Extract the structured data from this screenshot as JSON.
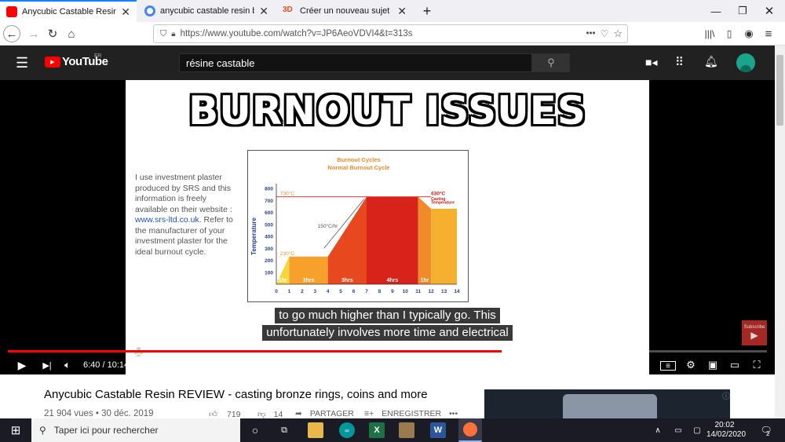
{
  "browser": {
    "tabs": [
      {
        "title": "Anycubic Castable Resin REVIEW",
        "favicon_color": "#ff0000",
        "active": true
      },
      {
        "title": "anycubic castable resin burnout",
        "favicon_color": "#4285f4",
        "active": false
      },
      {
        "title": "Créer un nouveau sujet - Forum",
        "favicon_color": "#e8491d",
        "active": false
      }
    ],
    "new_tab": "+",
    "url": "https://www.youtube.com/watch?v=JP6AeoVDVI4&t=313s",
    "url_more": "•••"
  },
  "youtube": {
    "logo": "YouTube",
    "region": "FR",
    "search_value": "résine castable"
  },
  "video": {
    "headline": "BURNOUT ISSUES",
    "side_text": "I use investment plaster produced by SRS and this information is freely available on their website : ",
    "side_link": "www.srs-ltd.co.uk",
    "side_text2": ". Refer to the manufacturer of your investment plaster for the ideal burnout cycle.",
    "captions": [
      "to go much higher than I typically go. This",
      "unfortunately involves more time and electrical"
    ],
    "time": "6:40 / 10:14",
    "progress": 0.65,
    "subscribe": "Subscribe"
  },
  "chart_data": {
    "type": "area",
    "title": "Burnout Cycles",
    "subtitle": "Normal Burnout Cycle",
    "ylabel": "Temperature",
    "xlabel": "",
    "x_ticks": [
      "0",
      "1",
      "2",
      "3",
      "4",
      "5",
      "6",
      "7",
      "8",
      "9",
      "10",
      "11",
      "12",
      "13",
      "14"
    ],
    "y_ticks": [
      "100",
      "200",
      "300",
      "400",
      "500",
      "600",
      "700",
      "800"
    ],
    "xlim": [
      0,
      14
    ],
    "ylim": [
      0,
      800
    ],
    "x": [
      0,
      1,
      4,
      7,
      11,
      12,
      14
    ],
    "y": [
      0,
      230,
      230,
      730,
      730,
      630,
      630
    ],
    "segments": [
      {
        "label": "1hr",
        "from": 0,
        "to": 1,
        "color": "#f5d63b"
      },
      {
        "label": "3hrs",
        "from": 1,
        "to": 4,
        "color": "#f7a12c"
      },
      {
        "label": "3hrs",
        "from": 4,
        "to": 7,
        "color": "#e8481e"
      },
      {
        "label": "4hrs",
        "from": 7,
        "to": 11,
        "color": "#d8231b"
      },
      {
        "label": "1hr",
        "from": 11,
        "to": 12,
        "color": "#f08a2a"
      },
      {
        "label": "",
        "from": 12,
        "to": 14,
        "color": "#f6b02f"
      }
    ],
    "annotations": [
      {
        "text": "730°C",
        "x": 0.3,
        "y": 730
      },
      {
        "text": "230°C",
        "x": 0.3,
        "y": 230
      },
      {
        "text": "150°C/hr",
        "x": 3.2,
        "y": 460
      },
      {
        "text": "630°C",
        "x": 12.0,
        "y": 730
      },
      {
        "text": "Casting",
        "x": 12.0,
        "y": 690
      },
      {
        "text": "Temperature",
        "x": 12.0,
        "y": 660
      }
    ],
    "grid": false
  },
  "below": {
    "title": "Anycubic Castable Resin REVIEW - casting bronze rings, coins and more",
    "meta": "21 904 vues • 30 déc. 2019",
    "likes": "719",
    "dislikes": "14",
    "share": "PARTAGER",
    "save": "ENREGISTRER"
  },
  "taskbar": {
    "search_placeholder": "Taper ici pour rechercher",
    "time": "20:02",
    "date": "14/02/2020",
    "notifications": "2"
  }
}
